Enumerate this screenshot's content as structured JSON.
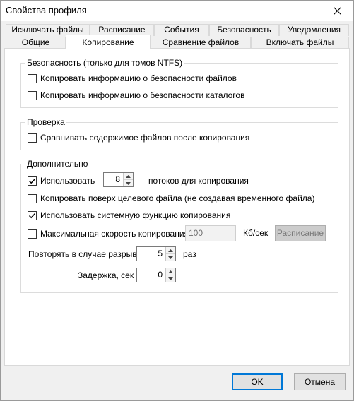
{
  "window": {
    "title": "Свойства профиля"
  },
  "tabs": {
    "row1": [
      "Исключать файлы",
      "Расписание",
      "События",
      "Безопасность",
      "Уведомления"
    ],
    "row2": [
      "Общие",
      "Копирование",
      "Сравнение файлов",
      "Включать файлы"
    ],
    "active": "Копирование"
  },
  "security": {
    "title": "Безопасность (только для томов NTFS)",
    "copy_file_security": {
      "label": "Копировать информацию о безопасности файлов",
      "checked": false
    },
    "copy_dir_security": {
      "label": "Копировать информацию о безопасности каталогов",
      "checked": false
    }
  },
  "verify": {
    "title": "Проверка",
    "compare_contents": {
      "label": "Сравнивать содержимое файлов после копирования",
      "checked": false
    }
  },
  "advanced": {
    "title": "Дополнительно",
    "use_threads": {
      "label": "Использовать",
      "checked": true,
      "value": "8",
      "suffix": "потоков для копирования"
    },
    "overwrite_target": {
      "label": "Копировать поверх целевого файла (не создавая временного файла)",
      "checked": false
    },
    "system_copy": {
      "label": "Использовать системную функцию копирования",
      "checked": true
    },
    "max_speed": {
      "label": "Максимальная скорость копирования",
      "checked": false,
      "value": "100",
      "unit": "Кб/сек",
      "schedule_button": "Расписание"
    },
    "retry": {
      "label": "Повторять в случае разрыва",
      "value": "5",
      "unit": "раз"
    },
    "delay": {
      "label": "Задержка, сек",
      "value": "0"
    }
  },
  "buttons": {
    "ok": "OK",
    "cancel": "Отмена"
  }
}
